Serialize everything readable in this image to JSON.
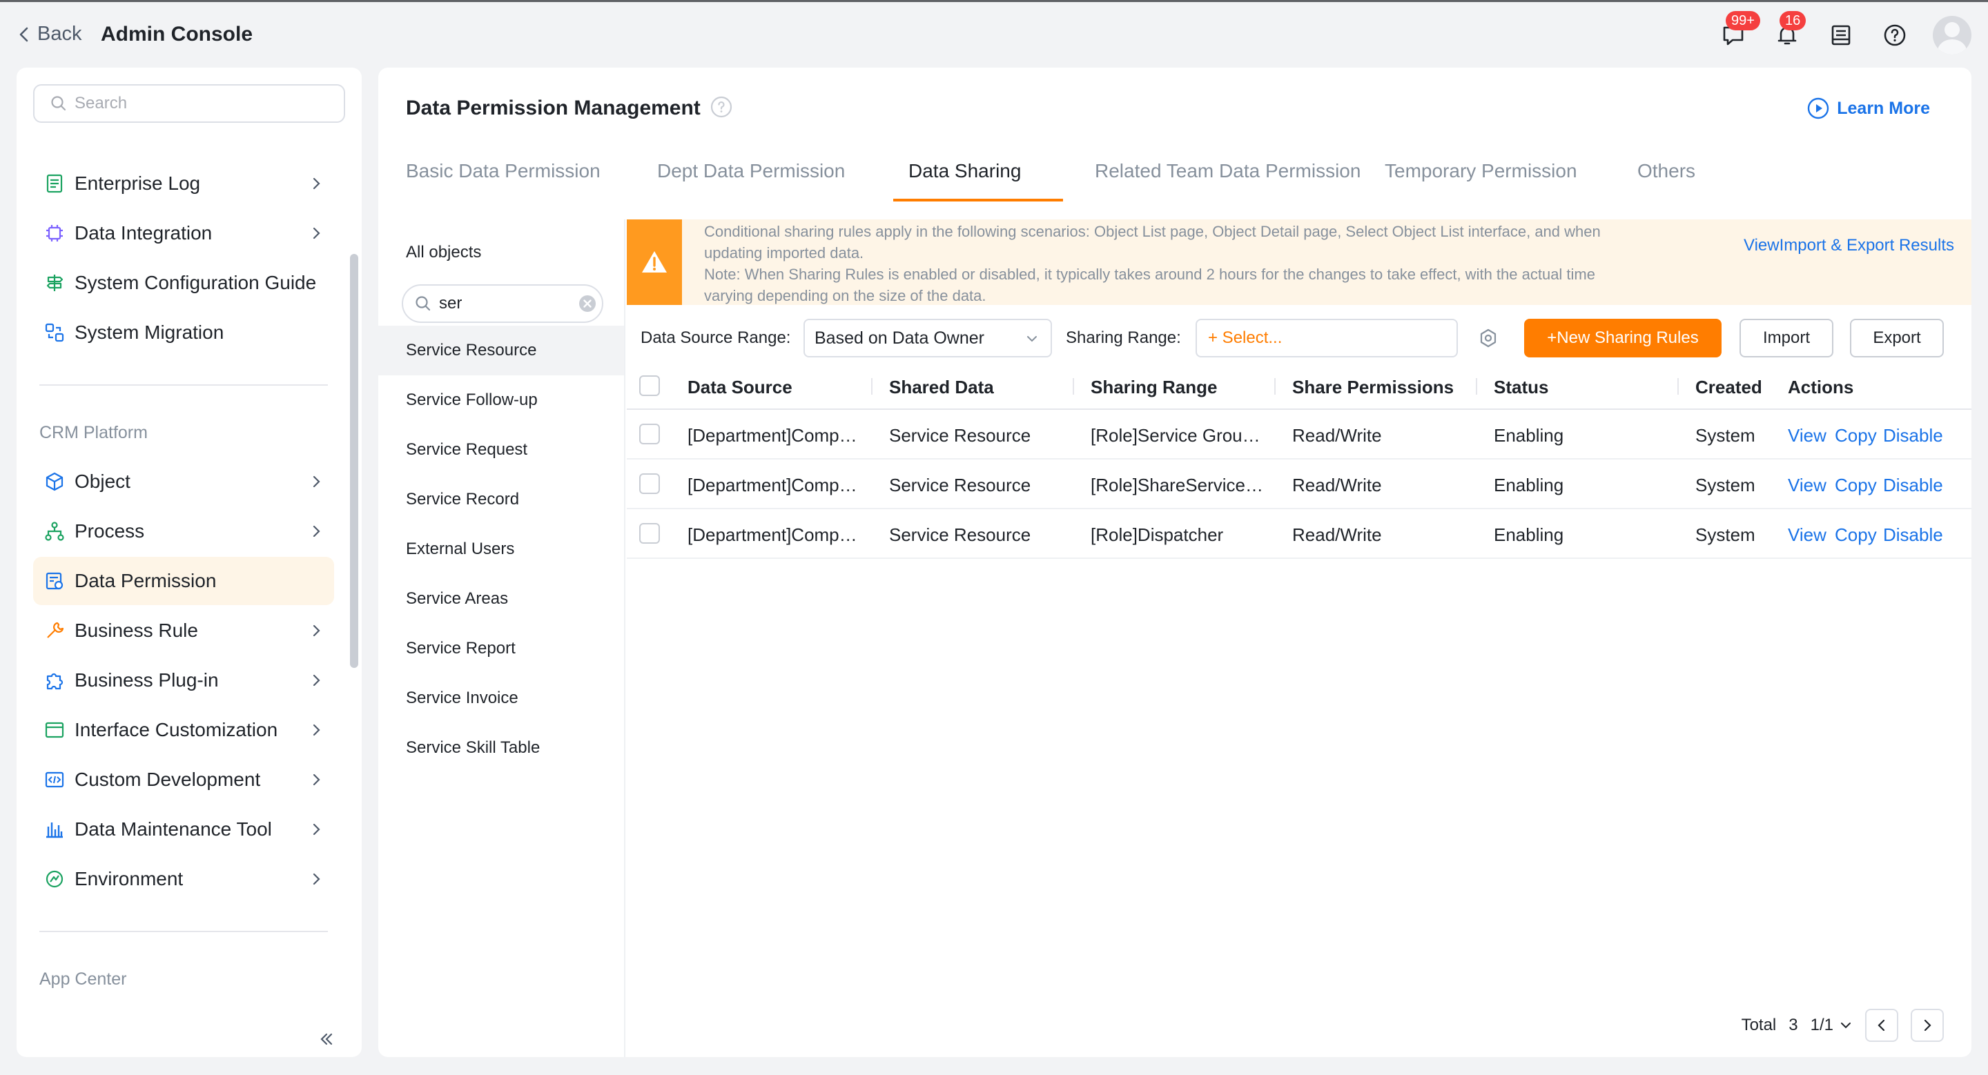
{
  "header": {
    "back_label": "Back",
    "title": "Admin Console",
    "chat_badge": "99+",
    "notification_badge": "16"
  },
  "sidebar": {
    "search_placeholder": "Search",
    "top_items": [
      {
        "label": "Enterprise Log",
        "icon": "log-icon"
      },
      {
        "label": "Data Integration",
        "icon": "chip-icon"
      },
      {
        "label": "System Configuration Guide",
        "icon": "signpost-icon"
      },
      {
        "label": "System Migration",
        "icon": "migration-icon"
      }
    ],
    "crm_section_label": "CRM Platform",
    "crm_items": [
      {
        "label": "Object",
        "icon": "cube-icon"
      },
      {
        "label": "Process",
        "icon": "process-icon"
      },
      {
        "label": "Data Permission",
        "icon": "data-permission-icon",
        "active": true
      },
      {
        "label": "Business Rule",
        "icon": "wrench-icon"
      },
      {
        "label": "Business Plug-in",
        "icon": "puzzle-icon"
      },
      {
        "label": "Interface Customization",
        "icon": "window-icon"
      },
      {
        "label": "Custom Development",
        "icon": "code-icon"
      },
      {
        "label": "Data Maintenance Tool",
        "icon": "bar-chart-icon"
      },
      {
        "label": "Environment",
        "icon": "environment-icon"
      }
    ],
    "app_center_label": "App Center"
  },
  "main": {
    "title": "Data Permission Management",
    "learn_more": "Learn More",
    "tabs": [
      {
        "label": "Basic Data Permission"
      },
      {
        "label": "Dept Data Permission"
      },
      {
        "label": "Data Sharing",
        "active": true
      },
      {
        "label": "Related Team Data Permission"
      },
      {
        "label": "Temporary Permission"
      },
      {
        "label": "Others"
      }
    ]
  },
  "objects": {
    "heading": "All objects",
    "search_value": "ser",
    "items": [
      "Service Resource",
      "Service Follow-up",
      "Service Request",
      "Service Record",
      "External Users",
      "Service Areas",
      "Service Report",
      "Service Invoice",
      "Service Skill Table"
    ]
  },
  "alert": {
    "line1": "Conditional sharing rules apply in the following scenarios: Object List page, Object Detail page, Select Object List interface, and when",
    "line2": "updating imported data.",
    "line3": "Note: When Sharing Rules is enabled or disabled, it typically takes around 2 hours for the changes to take effect, with the actual time",
    "line4": "varying depending on the size of the data.",
    "link": "ViewImport & Export Results"
  },
  "toolbar": {
    "data_source_label": "Data Source Range:",
    "data_source_value": "Based on Data Owner",
    "sharing_range_label": "Sharing Range:",
    "sharing_range_placeholder": "+ Select...",
    "new_button": "+New Sharing Rules",
    "import_button": "Import",
    "export_button": "Export"
  },
  "table": {
    "columns": [
      "Data Source",
      "Shared Data",
      "Sharing Range",
      "Share Permissions",
      "Status",
      "Created By",
      "Actions"
    ],
    "rows": [
      {
        "data_source": "[Department]Company-wide",
        "shared_data": "Service Resource",
        "sharing_range": "[Role]Service Group Leader",
        "permissions": "Read/Write",
        "status": "Enabling",
        "created_by": "System"
      },
      {
        "data_source": "[Department]Company-wide",
        "shared_data": "Service Resource",
        "sharing_range": "[Role]ShareServiceCenter",
        "permissions": "Read/Write",
        "status": "Enabling",
        "created_by": "System"
      },
      {
        "data_source": "[Department]Company-wide",
        "shared_data": "Service Resource",
        "sharing_range": "[Role]Dispatcher",
        "permissions": "Read/Write",
        "status": "Enabling",
        "created_by": "System"
      }
    ],
    "actions": {
      "view": "View",
      "copy": "Copy",
      "disable": "Disable"
    }
  },
  "pagination": {
    "total_label": "Total",
    "total": "3",
    "page": "1/1"
  },
  "colors": {
    "accent": "#ff7d00",
    "link": "#1a73e8",
    "alert_bg": "#fef5e7",
    "active_item_bg": "#fef5e7"
  }
}
